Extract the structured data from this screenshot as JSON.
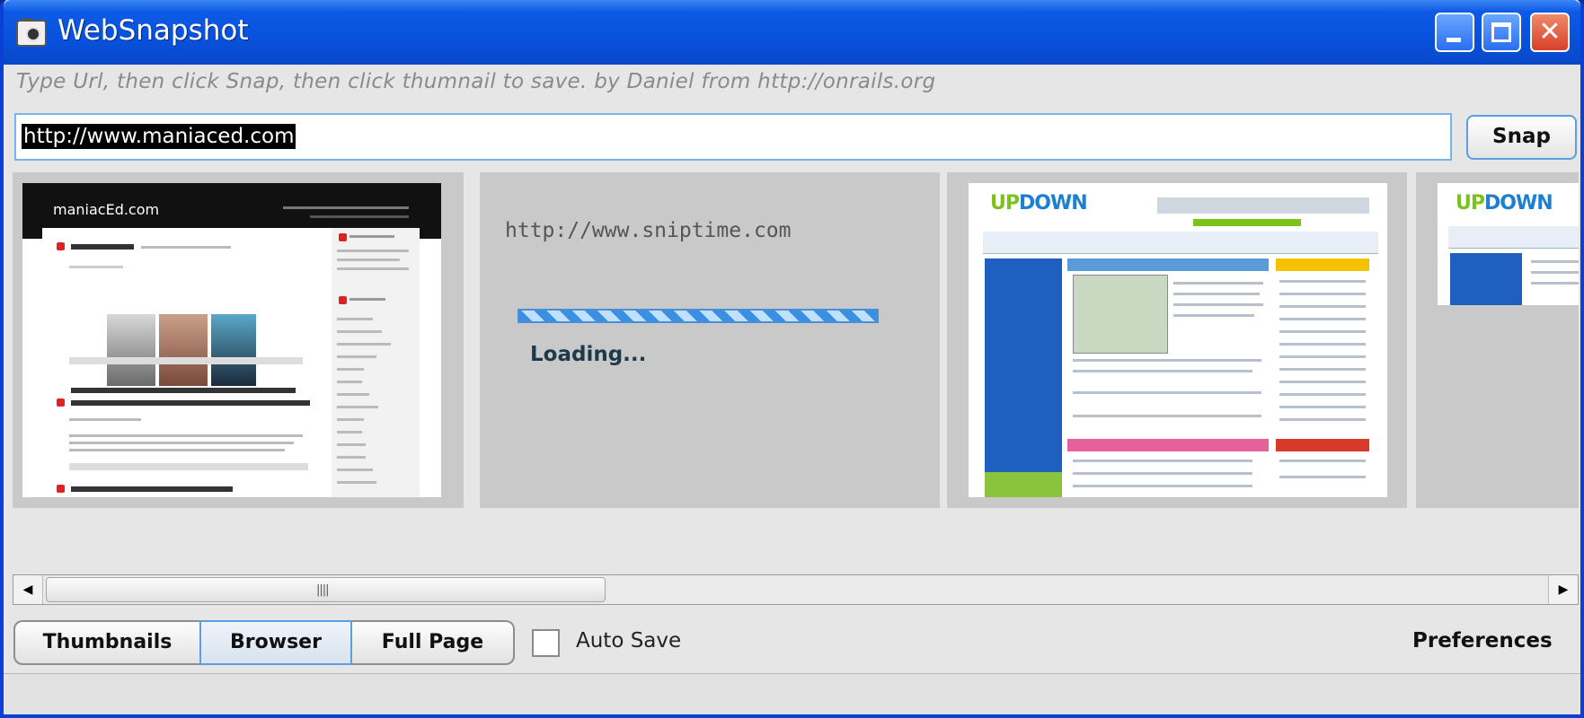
{
  "window": {
    "title": "WebSnapshot"
  },
  "hint": "Type Url, then click Snap, then click thumnail to save. by Daniel from http://onrails.org",
  "url_input": {
    "value": "http://www.maniaced.com"
  },
  "snap_button": "Snap",
  "thumbnails": [
    {
      "kind": "image",
      "site_logo": "maniacEd.com"
    },
    {
      "kind": "loading",
      "url": "http://www.sniptime.com",
      "status": "Loading...",
      "progress": "indeterminate"
    },
    {
      "kind": "image",
      "site_logo_a": "UP",
      "site_logo_b": "DOWN"
    },
    {
      "kind": "image",
      "site_logo_a": "UP",
      "site_logo_b": "DOWN"
    }
  ],
  "view_modes": {
    "thumbnails": "Thumbnails",
    "browser": "Browser",
    "full_page": "Full Page",
    "selected": "Browser"
  },
  "auto_save": {
    "label": "Auto Save",
    "checked": false
  },
  "preferences": "Preferences",
  "icons": {
    "app": "camera-icon",
    "minimize": "minimize-icon",
    "maximize": "maximize-icon",
    "close": "close-icon",
    "scroll_left": "arrow-left-icon",
    "scroll_right": "arrow-right-icon"
  },
  "colors": {
    "titlebar": "#0752dc",
    "accent": "#5a9fe0",
    "close": "#d8402a",
    "progress": "#3b8fe0"
  }
}
